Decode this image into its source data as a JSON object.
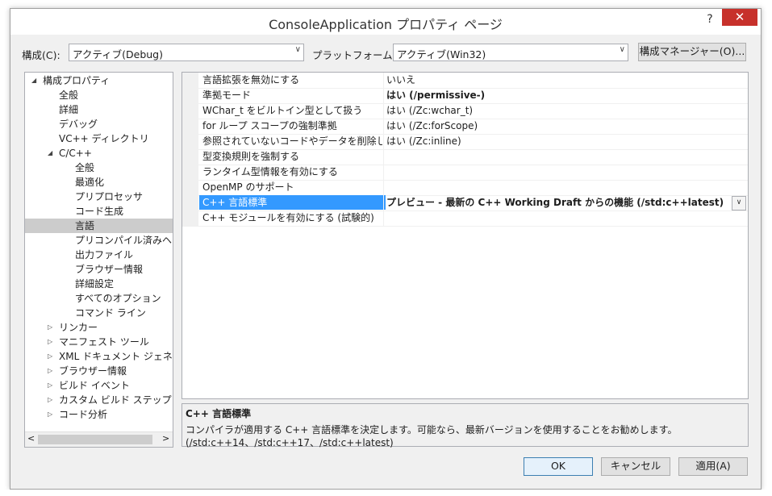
{
  "window": {
    "title": "ConsoleApplication プロパティ ページ",
    "help": "?",
    "close": "✕"
  },
  "toolbar": {
    "config_label": "構成(C):",
    "config_value": "アクティブ(Debug)",
    "platform_label": "プラットフォーム(P):",
    "platform_value": "アクティブ(Win32)",
    "config_manager": "構成マネージャー(O)..."
  },
  "tree": {
    "items": [
      {
        "label": "構成プロパティ",
        "toggle": "◢"
      },
      {
        "label": "全般"
      },
      {
        "label": "詳細"
      },
      {
        "label": "デバッグ"
      },
      {
        "label": "VC++ ディレクトリ"
      },
      {
        "label": "C/C++",
        "toggle": "◢"
      },
      {
        "label": "全般"
      },
      {
        "label": "最適化"
      },
      {
        "label": "プリプロセッサ"
      },
      {
        "label": "コード生成"
      },
      {
        "label": "言語"
      },
      {
        "label": "プリコンパイル済みヘッダー"
      },
      {
        "label": "出力ファイル"
      },
      {
        "label": "ブラウザー情報"
      },
      {
        "label": "詳細設定"
      },
      {
        "label": "すべてのオプション"
      },
      {
        "label": "コマンド ライン"
      },
      {
        "label": "リンカー",
        "toggle": "▷"
      },
      {
        "label": "マニフェスト ツール",
        "toggle": "▷"
      },
      {
        "label": "XML ドキュメント ジェネレータ",
        "toggle": "▷"
      },
      {
        "label": "ブラウザー情報",
        "toggle": "▷"
      },
      {
        "label": "ビルド イベント",
        "toggle": "▷"
      },
      {
        "label": "カスタム ビルド ステップ",
        "toggle": "▷"
      },
      {
        "label": "コード分析",
        "toggle": "▷"
      }
    ],
    "scroll_left": "<",
    "scroll_right": ">"
  },
  "grid": {
    "rows": [
      {
        "name": "言語拡張を無効にする",
        "value": "いいえ"
      },
      {
        "name": "準拠モード",
        "value": "はい (/permissive-)"
      },
      {
        "name": "WChar_t をビルトイン型として扱う",
        "value": "はい (/Zc:wchar_t)"
      },
      {
        "name": "for ループ スコープの強制準拠",
        "value": "はい (/Zc:forScope)"
      },
      {
        "name": "参照されていないコードやデータを削除します",
        "value": "はい (/Zc:inline)"
      },
      {
        "name": "型変換規則を強制する",
        "value": ""
      },
      {
        "name": "ランタイム型情報を有効にする",
        "value": ""
      },
      {
        "name": "OpenMP のサポート",
        "value": ""
      },
      {
        "name": "C++ 言語標準",
        "value": "プレビュー - 最新の C++ Working Draft からの機能 (/std:c++latest)"
      },
      {
        "name": "C++ モジュールを有効にする (試験的)",
        "value": ""
      }
    ],
    "dropdown_arrow": "∨"
  },
  "description": {
    "title": "C++ 言語標準",
    "text": "コンパイラが適用する C++ 言語標準を決定します。可能なら、最新バージョンを使用することをお勧めします。(/std:c++14、/std:c++17、/std:c++latest)"
  },
  "buttons": {
    "ok": "OK",
    "cancel": "キャンセル",
    "apply": "適用(A)"
  }
}
